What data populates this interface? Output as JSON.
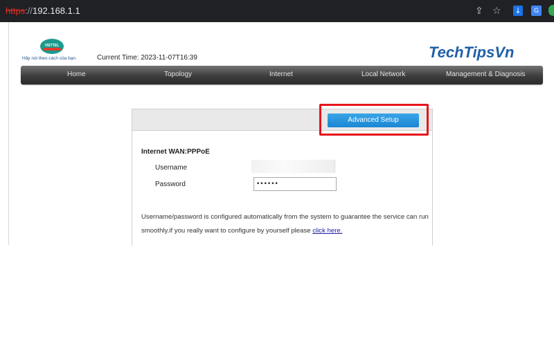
{
  "browser": {
    "url_scheme": "https",
    "url_sep": "://",
    "url_host": "192.168.1.1",
    "share_icon": "share-icon",
    "star_icon": "star-icon",
    "download_icon": "download-icon",
    "translate_icon": "translate-icon",
    "extension_icon": "extension-icon"
  },
  "header": {
    "logo_tagline": "Hãy nói theo cách của bạn",
    "logo_text": "VIETTEL",
    "current_time": "Current Time: 2023-11-07T16:39",
    "watermark": "TechTipsVn"
  },
  "nav": {
    "items": [
      "Home",
      "Topology",
      "Internet",
      "Local Network",
      "Management & Diagnosis"
    ]
  },
  "panel": {
    "advanced_button": "Advanced Setup",
    "wan_title": "Internet WAN:PPPoE",
    "username_label": "Username",
    "username_value": "",
    "password_label": "Password",
    "password_value": "••••••",
    "note_text": "Username/password is configured automatically from the system to guarantee the service can run smoothly.if you really want to configure by yourself please ",
    "note_link": "click here."
  },
  "colors": {
    "accent_button": "#1b86d2",
    "highlight_box": "#e5141b",
    "nav_bar": "#3d3d3d",
    "link": "#1c1ca8"
  }
}
